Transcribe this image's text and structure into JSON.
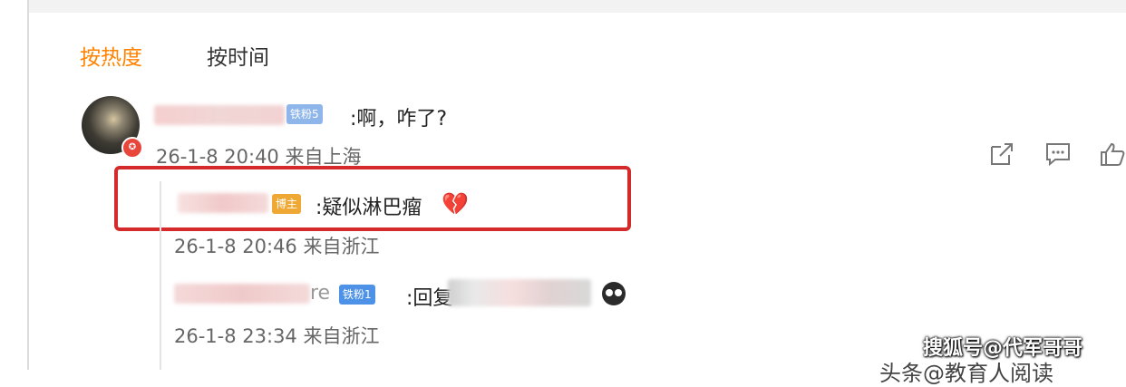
{
  "tabs": {
    "hot": "按热度",
    "time": "按时间"
  },
  "comment": {
    "badge": "铁粉5",
    "text": ":啊，咋了?",
    "meta": "26-1-8 20:40 来自上海",
    "actions": [
      "share-icon",
      "comment-icon",
      "like-icon"
    ]
  },
  "replies": [
    {
      "badge": "博主",
      "text": ":疑似淋巴瘤",
      "emoji": "broken-heart",
      "meta": "26-1-8 20:46 来自浙江"
    },
    {
      "name_tail": "re",
      "badge": "铁粉1",
      "text": ":回复",
      "meta": "26-1-8 23:34 来自浙江"
    }
  ],
  "watermark": "搜狐号@代军哥哥",
  "watermark2": "头条@教育人阅读",
  "colors": {
    "accent": "#ff8200",
    "highlight_box": "#d42a2a"
  }
}
